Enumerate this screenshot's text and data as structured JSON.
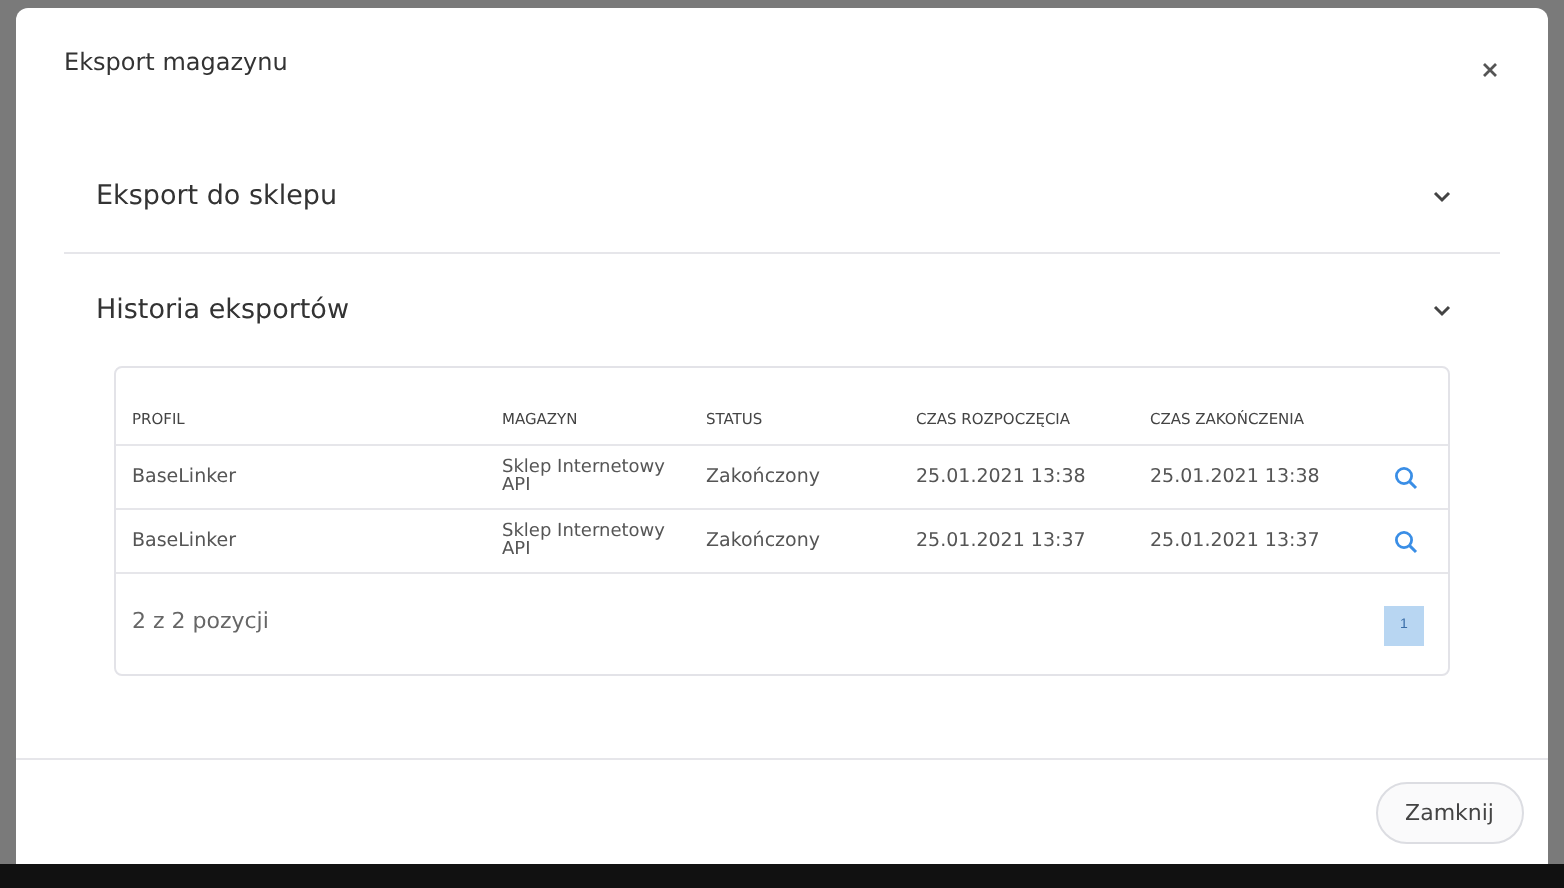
{
  "dialog": {
    "title": "Eksport magazynu",
    "sections": [
      {
        "title": "Eksport do sklepu"
      },
      {
        "title": "Historia eksportów",
        "table": {
          "columns": [
            "PROFIL",
            "MAGAZYN",
            "STATUS",
            "CZAS ROZPOCZĘCIA",
            "CZAS ZAKOŃCZENIA"
          ],
          "rows": [
            [
              "BaseLinker",
              "Sklep Internetowy API",
              "Zakończony",
              "25.01.2021 13:38",
              "25.01.2021 13:38"
            ],
            [
              "BaseLinker",
              "Sklep Internetowy API",
              "Zakończony",
              "25.01.2021 13:37",
              "25.01.2021 13:37"
            ]
          ],
          "summary": "2 z 2 pozycji",
          "pages": [
            {
              "label": "1",
              "selected": true
            }
          ]
        }
      }
    ],
    "buttons": [
      "Zamknij"
    ]
  }
}
